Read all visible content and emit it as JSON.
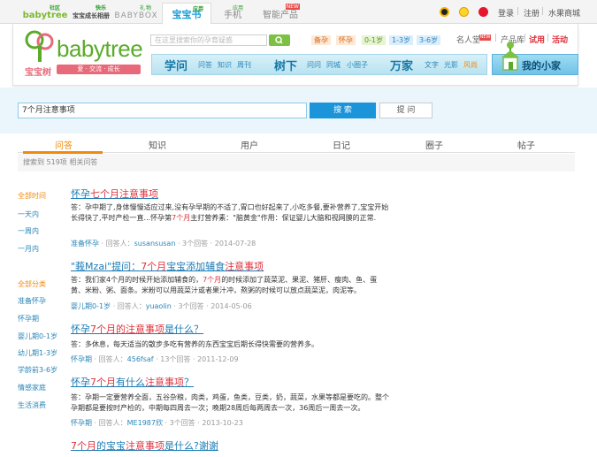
{
  "topbar": {
    "products": [
      {
        "label": "babytree",
        "tag": "社区"
      },
      {
        "label": "宝宝成长相册",
        "tag": "快乐"
      },
      {
        "label": "BABYBOX",
        "tag": "礼物"
      },
      {
        "label": "宝宝书",
        "tag": "应用"
      },
      {
        "label": "手机",
        "tag": "应用"
      },
      {
        "label": "智能产品",
        "tag": "NEW"
      }
    ],
    "login": "登录",
    "register": "注册",
    "mall": "水果商城",
    "divider": "|"
  },
  "header": {
    "logo_text": "babytree",
    "logo_cn": "宝宝树",
    "slogan": "爱 · 交流 · 成长",
    "search_placeholder": "在这里搜索你的孕育疑惑",
    "stages": [
      "备孕",
      "怀孕",
      "0-1岁",
      "1-3岁",
      "3-6岁"
    ],
    "links": [
      "名人堂",
      "产品库",
      "试用",
      "活动"
    ],
    "links_divider": "|",
    "nav": [
      {
        "title": "学问",
        "subs": [
          "问答",
          "知识",
          "周刊"
        ]
      },
      {
        "title": "树下",
        "subs": [
          "问问",
          "同城",
          "小圈子"
        ]
      },
      {
        "title": "万家",
        "subs": [
          "文字",
          "光影",
          "风尚"
        ]
      }
    ],
    "home_label": "我的小家"
  },
  "search": {
    "query": "7个月注意事项",
    "search_button": "搜 索",
    "ask_button": "提 问"
  },
  "tabs": [
    "问答",
    "知识",
    "用户",
    "日记",
    "圈子",
    "帖子"
  ],
  "result_count": "搜索到 519项 相关问答",
  "filters": {
    "time": [
      "全部时间",
      "一天内",
      "一周内",
      "一月内"
    ],
    "category": [
      "全部分类",
      "准备怀孕",
      "怀孕期",
      "婴儿期0-1岁",
      "幼儿期1-3岁",
      "学龄前3-6岁",
      "情感家庭",
      "生活消费"
    ]
  },
  "results": [
    {
      "title": [
        "怀孕",
        "七个月",
        "注意事项",
        ""
      ],
      "body": [
        "答：孕中期了,身体慢慢适应过来,没有孕早期的不适了,胃口也好起来了,小吃多餐,要补营养了,宝宝开始长得快了,平时产检一直...怀孕第",
        "7个月",
        "主打营养素：\"脑黄金\"作用：保证婴儿大脑和视网膜的正常."
      ],
      "category": "准备怀孕",
      "answerer_label": "回答人：",
      "answerer": "susansusan",
      "answers": "3个回答",
      "date": "2014-07-28"
    },
    {
      "title": [
        "\"莪Mzai\"提问：",
        "7个月",
        "宝宝添加辅食",
        "注意事项"
      ],
      "body": [
        "答：我们家4个月的时候开始添加辅食的，",
        "7个月",
        "的时候添加了蔬菜泥、果泥、猪肝、瘦肉、鱼、蛋黄、米粉、粥、面条。米粉可以用蔬菜汁或者果汁冲，熬粥的时候可以放点蔬菜泥，肉泥等。"
      ],
      "category": "婴儿期0-1岁",
      "answerer_label": "回答人：",
      "answerer": "yuaolin",
      "answers": "3个回答",
      "date": "2014-05-06"
    },
    {
      "title": [
        "怀孕",
        "7个月",
        "的注意事项",
        "是什么？"
      ],
      "body": [
        "答：多休息，每天适当的散步多吃有营养的东西宝宝后期长得快需要的营养多。",
        "",
        ""
      ],
      "category": "怀孕期",
      "answerer_label": "回答人：",
      "answerer": "456fsaf",
      "answers": "13个回答",
      "date": "2011-12-09"
    },
    {
      "title": [
        "怀孕",
        "7个月",
        "有什么",
        "注意事项",
        "？"
      ],
      "body": [
        "答：孕期一定要营养全面，五谷杂粮，肉类，鸡蛋，鱼类，豆类，奶，蔬菜，水果等都是要吃的。整个孕期都是要按时产检的，中期每四周去一次；晚期28周后每两周去一次，36周后一周去一次。",
        "",
        ""
      ],
      "category": "怀孕期",
      "answerer_label": "回答人：",
      "answerer": "ME1987欣",
      "answers": "3个回答",
      "date": "2013-10-23"
    },
    {
      "title": [
        "7个月",
        "的宝宝",
        "注意事项",
        "是什么?谢谢"
      ],
      "category": "",
      "answerer_label": "",
      "answerer": "",
      "answers": "",
      "date": ""
    }
  ],
  "colors": {
    "accent": "#f08a0b",
    "link": "#1a7bb5",
    "highlight": "#e0303a",
    "brand": "#5aab2a",
    "button": "#1c94d9"
  }
}
